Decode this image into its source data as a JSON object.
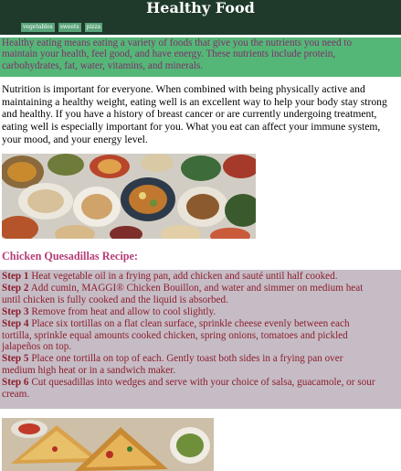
{
  "header": {
    "title": "Healthy Food",
    "nav": [
      {
        "label": "vegetables"
      },
      {
        "label": "sweets"
      },
      {
        "label": "pizza"
      }
    ]
  },
  "intro": {
    "lines": [
      "Healthy eating means eating a variety of foods that give you the nutrients you need to",
      "maintain your health, feel good, and have energy. These nutrients include protein,",
      "carbohydrates, fat, water, vitamins, and minerals."
    ]
  },
  "nutrition": {
    "lines": [
      "Nutrition is important for everyone. When combined with being physically active and",
      "maintaining a healthy weight, eating well is an excellent way to help your body stay strong",
      "and healthy. If you have a history of breast cancer or are currently undergoing treatment,",
      "eating well is especially important for you. What you eat can affect your immune system,",
      "your mood, and your energy level."
    ]
  },
  "recipe": {
    "title": "Chicken Quesadillas Recipe:",
    "lines": [
      {
        "num": "Step 1",
        "text": " Heat vegetable oil in a frying pan, add chicken and sauté until half cooked."
      },
      {
        "num": "Step 2",
        "text": " Add cumin, MAGGI® Chicken Bouillon, and water and simmer on medium heat"
      },
      {
        "num": "",
        "text": "until chicken is fully cooked and the liquid is absorbed."
      },
      {
        "num": "Step 3",
        "text": " Remove from heat and allow to cool slightly."
      },
      {
        "num": "Step 4",
        "text": " Place six tortillas on a flat clean surface, sprinkle cheese evenly between each"
      },
      {
        "num": "",
        "text": "tortilla, sprinkle equal amounts cooked chicken, spring onions, tomatoes and pickled"
      },
      {
        "num": "",
        "text": "jalapeños on top."
      },
      {
        "num": "Step 5",
        "text": " Place one tortilla on top of each. Gently toast both sides in a frying pan over"
      },
      {
        "num": "",
        "text": "medium high heat or in a sandwich maker."
      },
      {
        "num": "Step 6",
        "text": " Cut quesadillas into wedges and serve with your choice of salsa, guacamole, or sour"
      },
      {
        "num": "",
        "text": "cream."
      }
    ]
  }
}
